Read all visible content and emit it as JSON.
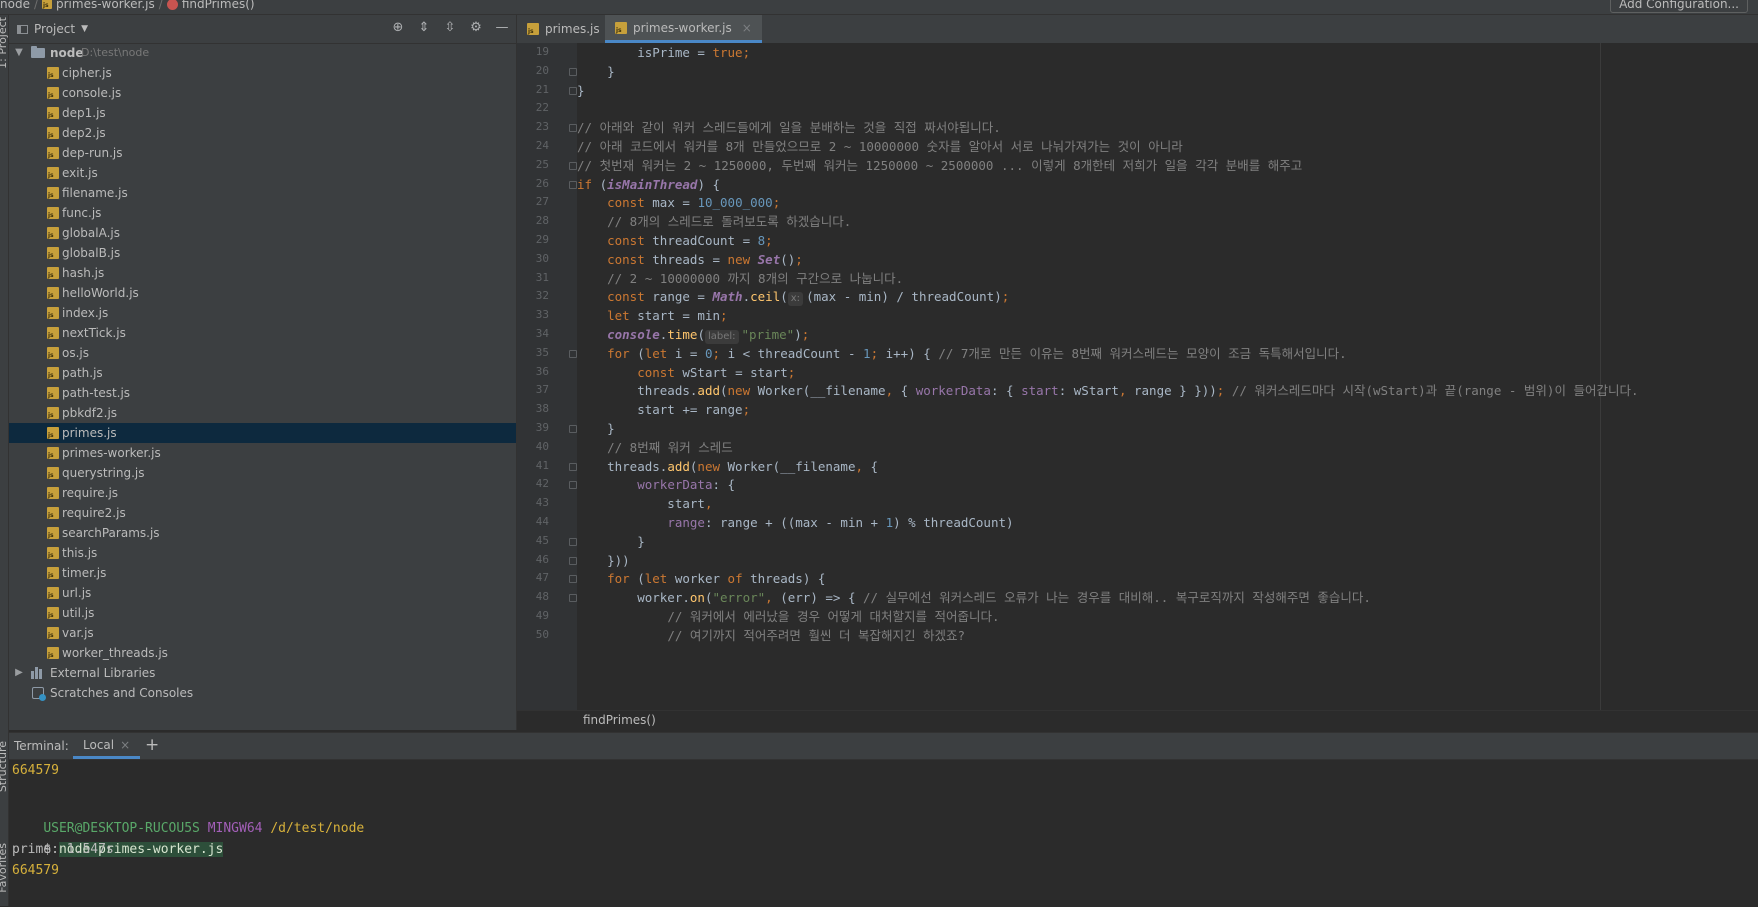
{
  "breadcrumb": {
    "root": "node",
    "file": "primes-worker.js",
    "func": "findPrimes()"
  },
  "toolbar": {
    "add_config": "Add Configuration..."
  },
  "side_tabs": {
    "project": "1: Project",
    "structure": "Structure",
    "favorites": "Favorites"
  },
  "project": {
    "title": "Project",
    "root": {
      "name": "node",
      "path": "D:\\test\\node"
    },
    "files": [
      "cipher.js",
      "console.js",
      "dep1.js",
      "dep2.js",
      "dep-run.js",
      "exit.js",
      "filename.js",
      "func.js",
      "globalA.js",
      "globalB.js",
      "hash.js",
      "helloWorld.js",
      "index.js",
      "nextTick.js",
      "os.js",
      "path.js",
      "path-test.js",
      "pbkdf2.js",
      "primes.js",
      "primes-worker.js",
      "querystring.js",
      "require.js",
      "require2.js",
      "searchParams.js",
      "this.js",
      "timer.js",
      "url.js",
      "util.js",
      "var.js",
      "worker_threads.js"
    ],
    "selected": "primes.js",
    "external": "External Libraries",
    "scratches": "Scratches and Consoles"
  },
  "tabs": [
    {
      "label": "primes.js",
      "active": false
    },
    {
      "label": "primes-worker.js",
      "active": true
    }
  ],
  "editor": {
    "first_line": 19,
    "line_numbers": [
      19,
      20,
      21,
      22,
      23,
      24,
      25,
      26,
      27,
      28,
      29,
      30,
      31,
      32,
      33,
      34,
      35,
      36,
      37,
      38,
      39,
      40,
      41,
      42,
      43,
      44,
      45,
      46,
      47,
      48,
      49,
      50
    ],
    "breadcrumb": "findPrimes()",
    "lines": [
      [
        {
          "t": "        "
        },
        {
          "t": "isPrime",
          "c": ""
        },
        {
          "t": " = "
        },
        {
          "t": "true",
          "c": "k"
        },
        {
          "t": ";",
          "c": "k"
        }
      ],
      [
        {
          "t": "    }"
        }
      ],
      [
        {
          "t": "}"
        }
      ],
      [
        {
          "t": ""
        }
      ],
      [
        {
          "t": "// 아래와 같이 워커 스레드들에게 일을 분배하는 것을 직접 짜서야됩니다.",
          "c": "c"
        }
      ],
      [
        {
          "t": "// 아래 코드에서 워커를 8개 만들었으므로 2 ~ 10000000 숫자를 알아서 서로 나눠가져가는 것이 아니라",
          "c": "c"
        }
      ],
      [
        {
          "t": "// 첫번재 워커는 2 ~ 1250000, 두번째 워커는 1250000 ~ 2500000 ... 이렇게 8개한테 저희가 일을 각각 분배를 해주고",
          "c": "c"
        }
      ],
      [
        {
          "t": "if",
          "c": "k"
        },
        {
          "t": " ("
        },
        {
          "t": "isMainThread",
          "c": "i"
        },
        {
          "t": ") {"
        }
      ],
      [
        {
          "t": "    "
        },
        {
          "t": "const",
          "c": "k"
        },
        {
          "t": " max = "
        },
        {
          "t": "10_000_000",
          "c": "n"
        },
        {
          "t": ";",
          "c": "k"
        }
      ],
      [
        {
          "t": "    "
        },
        {
          "t": "// 8개의 스레드로 돌려보도록 하겠습니다.",
          "c": "c"
        }
      ],
      [
        {
          "t": "    "
        },
        {
          "t": "const",
          "c": "k"
        },
        {
          "t": " threadCount = "
        },
        {
          "t": "8",
          "c": "n"
        },
        {
          "t": ";",
          "c": "k"
        }
      ],
      [
        {
          "t": "    "
        },
        {
          "t": "const",
          "c": "k"
        },
        {
          "t": " threads = "
        },
        {
          "t": "new ",
          "c": "k"
        },
        {
          "t": "Set",
          "c": "i"
        },
        {
          "t": "()"
        },
        {
          "t": ";",
          "c": "k"
        }
      ],
      [
        {
          "t": "    "
        },
        {
          "t": "// 2 ~ 10000000 까지 8개의 구간으로 나눕니다.",
          "c": "c"
        }
      ],
      [
        {
          "t": "    "
        },
        {
          "t": "const",
          "c": "k"
        },
        {
          "t": " range = "
        },
        {
          "t": "Math",
          "c": "i"
        },
        {
          "t": "."
        },
        {
          "t": "ceil",
          "c": "f"
        },
        {
          "t": "("
        },
        {
          "hint": "x:"
        },
        {
          "t": "(max - min) / threadCount)"
        },
        {
          "t": ";",
          "c": "k"
        }
      ],
      [
        {
          "t": "    "
        },
        {
          "t": "let",
          "c": "k"
        },
        {
          "t": " start = min"
        },
        {
          "t": ";",
          "c": "k"
        }
      ],
      [
        {
          "t": "    "
        },
        {
          "t": "console",
          "c": "i"
        },
        {
          "t": "."
        },
        {
          "t": "time",
          "c": "f"
        },
        {
          "t": "("
        },
        {
          "hint": "label:"
        },
        {
          "t": "\"prime\"",
          "c": "s"
        },
        {
          "t": ")"
        },
        {
          "t": ";",
          "c": "k"
        }
      ],
      [
        {
          "t": "    "
        },
        {
          "t": "for",
          "c": "k"
        },
        {
          "t": " ("
        },
        {
          "t": "let",
          "c": "k"
        },
        {
          "t": " i = "
        },
        {
          "t": "0",
          "c": "n"
        },
        {
          "t": "; ",
          "c": "k"
        },
        {
          "t": "i < threadCount - "
        },
        {
          "t": "1",
          "c": "n"
        },
        {
          "t": "; ",
          "c": "k"
        },
        {
          "t": "i++) { "
        },
        {
          "t": "// 7개로 만든 이유는 8번째 워커스레드는 모양이 조금 독특해서입니다.",
          "c": "c"
        }
      ],
      [
        {
          "t": "        "
        },
        {
          "t": "const",
          "c": "k"
        },
        {
          "t": " wStart = start"
        },
        {
          "t": ";",
          "c": "k"
        }
      ],
      [
        {
          "t": "        threads."
        },
        {
          "t": "add",
          "c": "f"
        },
        {
          "t": "("
        },
        {
          "t": "new ",
          "c": "k"
        },
        {
          "t": "Worker(__filename"
        },
        {
          "t": ", ",
          "c": "k"
        },
        {
          "t": "{ "
        },
        {
          "t": "workerData",
          "c": "p"
        },
        {
          "t": ": { "
        },
        {
          "t": "start",
          "c": "p"
        },
        {
          "t": ": wStart"
        },
        {
          "t": ", ",
          "c": "k"
        },
        {
          "t": "range } }))"
        },
        {
          "t": ";",
          "c": "k"
        },
        {
          "t": " // 워커스레드마다 시작(wStart)과 끝(range - 범위)이 들어갑니다.",
          "c": "c"
        }
      ],
      [
        {
          "t": "        start += range"
        },
        {
          "t": ";",
          "c": "k"
        }
      ],
      [
        {
          "t": "    }"
        }
      ],
      [
        {
          "t": "    "
        },
        {
          "t": "// 8번째 워커 스레드",
          "c": "c"
        }
      ],
      [
        {
          "t": "    threads."
        },
        {
          "t": "add",
          "c": "f"
        },
        {
          "t": "("
        },
        {
          "t": "new ",
          "c": "k"
        },
        {
          "t": "Worker(__filename"
        },
        {
          "t": ", ",
          "c": "k"
        },
        {
          "t": "{"
        }
      ],
      [
        {
          "t": "        "
        },
        {
          "t": "workerData",
          "c": "p"
        },
        {
          "t": ": {"
        }
      ],
      [
        {
          "t": "            start"
        },
        {
          "t": ",",
          "c": "k"
        }
      ],
      [
        {
          "t": "            "
        },
        {
          "t": "range",
          "c": "p"
        },
        {
          "t": ": range + ((max - min + "
        },
        {
          "t": "1",
          "c": "n"
        },
        {
          "t": ") % threadCount)"
        }
      ],
      [
        {
          "t": "        }"
        }
      ],
      [
        {
          "t": "    }))"
        }
      ],
      [
        {
          "t": "    "
        },
        {
          "t": "for",
          "c": "k"
        },
        {
          "t": " ("
        },
        {
          "t": "let",
          "c": "k"
        },
        {
          "t": " worker "
        },
        {
          "t": "of",
          "c": "k"
        },
        {
          "t": " threads) {"
        }
      ],
      [
        {
          "t": "        worker."
        },
        {
          "t": "on",
          "c": "f"
        },
        {
          "t": "("
        },
        {
          "t": "\"error\"",
          "c": "s"
        },
        {
          "t": ", ",
          "c": "k"
        },
        {
          "t": "(err) => { "
        },
        {
          "t": "// 실무에선 워커스레드 오류가 나는 경우를 대비해.. 복구로직까지 작성해주면 좋습니다.",
          "c": "c"
        }
      ],
      [
        {
          "t": "            "
        },
        {
          "t": "// 워커에서 에러났을 경우 어떻게 대처할지를 적어줍니다.",
          "c": "c"
        }
      ],
      [
        {
          "t": "            "
        },
        {
          "t": "// 여기까지 적어주려면 훨씬 더 복잡해지긴 하겠죠?",
          "c": "c"
        }
      ]
    ]
  },
  "terminal": {
    "title": "Terminal:",
    "tab": "Local",
    "lines": {
      "out1": "664579",
      "user": "USER@DESKTOP-RUCOU5S",
      "shell": "MINGW64",
      "cwd": "/d/test/node",
      "prompt": "$",
      "command": "node primes-worker.js",
      "time": "prime: 1.547s",
      "out2": "664579"
    }
  }
}
